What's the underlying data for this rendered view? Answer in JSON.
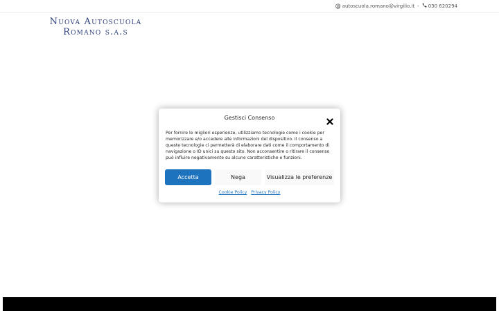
{
  "header": {
    "email": "autoscuola.romano@virgilio.it",
    "separator": "-",
    "phone": "030 620294",
    "email_icon": "at-icon",
    "phone_icon": "phone-icon"
  },
  "logo": {
    "line1": "Nuova Autoscuola",
    "line2": "Romano s.a.s",
    "color": "#2c3e7a"
  },
  "consent": {
    "title": "Gestisci Consenso",
    "body": "Per fornire le migliori esperienze, utilizziamo tecnologie come i cookie per memorizzare e/o accedere alle informazioni del dispositivo. Il consenso a queste tecnologie ci permetterà di elaborare dati come il comportamento di navigazione o ID unici su questo sito. Non acconsentire o ritirare il consenso può influire negativamente su alcune caratteristiche e funzioni.",
    "accept_label": "Accetta",
    "deny_label": "Nega",
    "preferences_label": "Visualizza le preferenze",
    "cookie_policy_label": "Cookie Policy",
    "privacy_policy_label": "Privacy Policy",
    "accent_color": "#1e73be"
  }
}
